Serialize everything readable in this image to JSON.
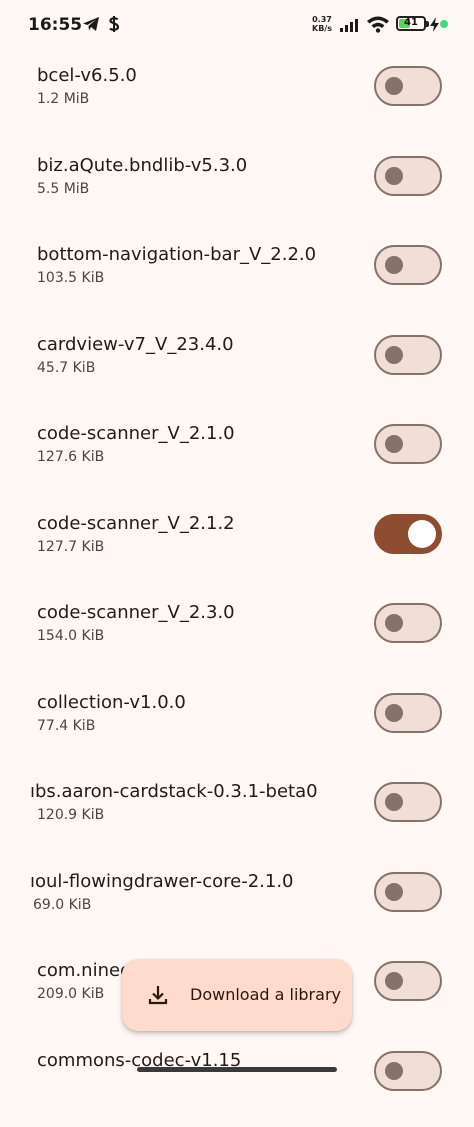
{
  "status_bar": {
    "time": "16:55",
    "net_speed_value": "0.37",
    "net_speed_unit": "KB/s",
    "battery_level": "41",
    "icons": [
      "telegram-icon",
      "dollar-icon",
      "signal-icon",
      "wifi-icon",
      "battery-icon",
      "charging-icon",
      "dot-icon"
    ]
  },
  "libraries": [
    {
      "name": "bcel-v6.5.0",
      "size": "1.2 MiB",
      "enabled": false
    },
    {
      "name": "biz.aQute.bndlib-v5.3.0",
      "size": "5.5 MiB",
      "enabled": false
    },
    {
      "name": "bottom-navigation-bar_V_2.2.0",
      "size": "103.5 KiB",
      "enabled": false
    },
    {
      "name": "cardview-v7_V_23.4.0",
      "size": "45.7 KiB",
      "enabled": false
    },
    {
      "name": "code-scanner_V_2.1.0",
      "size": "127.6 KiB",
      "enabled": false
    },
    {
      "name": "code-scanner_V_2.1.2",
      "size": "127.7 KiB",
      "enabled": true
    },
    {
      "name": "code-scanner_V_2.3.0",
      "size": "154.0 KiB",
      "enabled": false
    },
    {
      "name": "collection-v1.0.0",
      "size": "77.4 KiB",
      "enabled": false
    },
    {
      "name": "ıbs.aaron-cardstack-0.3.1-beta0",
      "size": "120.9 KiB",
      "enabled": false
    },
    {
      "name": "ıoul-flowingdrawer-core-2.1.0",
      "size": "69.0 KiB",
      "enabled": false
    },
    {
      "name": "com.ninec",
      "size": "209.0 KiB",
      "enabled": false
    },
    {
      "name": "commons-codec-v1.15",
      "size": "",
      "enabled": false
    }
  ],
  "fab": {
    "label": "Download a library",
    "icon": "download-icon"
  },
  "colors": {
    "accent": "#8e4c30",
    "background": "#fff8f5",
    "fab": "#ffdbcd"
  }
}
